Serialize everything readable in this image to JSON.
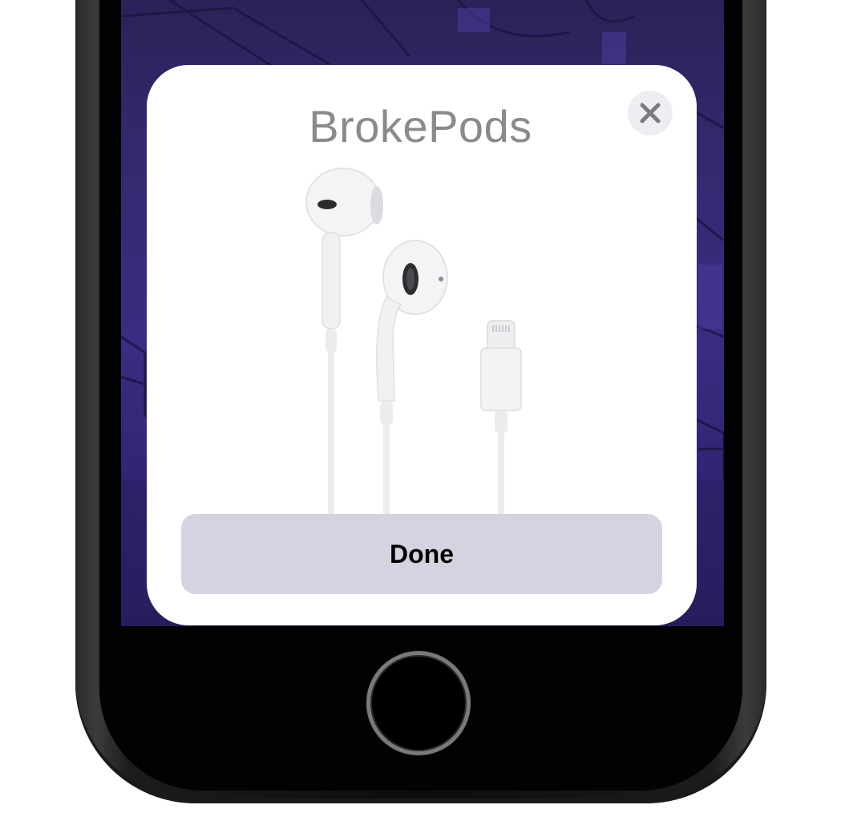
{
  "popup": {
    "title": "BrokePods",
    "close_icon": "close-icon",
    "product_image": "wired-earphones-lightning",
    "done_label": "Done"
  },
  "device": {
    "home_button": "home-button"
  },
  "colors": {
    "card_background": "#ffffff",
    "title_text": "#8a8a8e",
    "done_button_fill": "#d4d3df",
    "close_button_fill": "#eeeef2",
    "wallpaper": "#352a72"
  }
}
